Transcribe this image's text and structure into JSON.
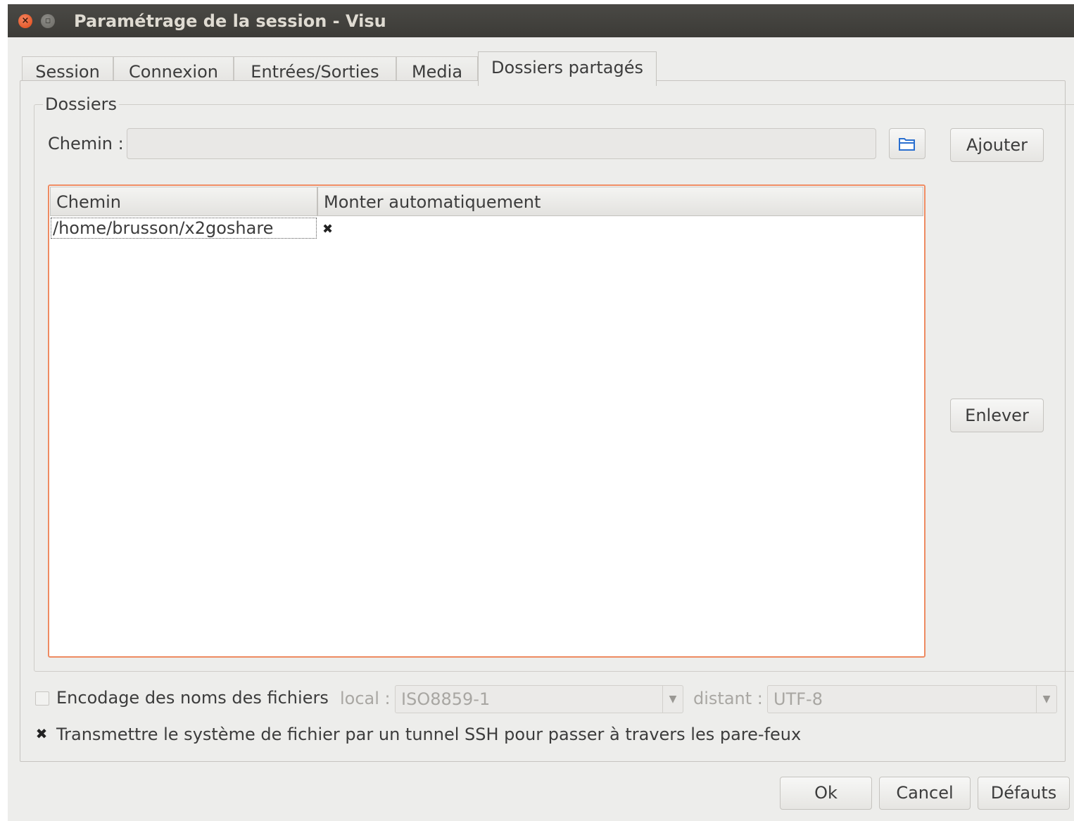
{
  "window": {
    "title": "Paramétrage de la session - Visu",
    "close_glyph": "×",
    "minimize_glyph": "▫"
  },
  "tabs": [
    {
      "label": "Session",
      "active": false
    },
    {
      "label": "Connexion",
      "active": false
    },
    {
      "label": "Entrées/Sorties",
      "active": false
    },
    {
      "label": "Media",
      "active": false
    },
    {
      "label": "Dossiers partagés",
      "active": true
    }
  ],
  "folders": {
    "group_title": "Dossiers",
    "path_label": "Chemin :",
    "path_value": "",
    "add_label": "Ajouter",
    "remove_label": "Enlever",
    "folder_icon": "folder-open-icon",
    "table": {
      "columns": [
        "Chemin",
        "Monter automatiquement"
      ],
      "rows": [
        {
          "path": "/home/brusson/x2goshare",
          "automount_glyph": "✖"
        }
      ]
    }
  },
  "encoding": {
    "checkbox_label": "Encodage des noms des fichiers",
    "checked": false,
    "local_label": "local :",
    "local_value": "ISO8859-1",
    "remote_label": "distant :",
    "remote_value": "UTF-8"
  },
  "ssh_tunnel": {
    "checkbox_label": "Transmettre le système de fichier par un tunnel SSH pour passer à travers les pare-feux",
    "checked_glyph": "✖"
  },
  "footer": {
    "ok_label": "Ok",
    "cancel_label": "Cancel",
    "defaults_label": "Défauts"
  },
  "colors": {
    "focus_border": "#ee8b62",
    "titlebar": "#3c3b37",
    "close_button": "#df4a16"
  }
}
